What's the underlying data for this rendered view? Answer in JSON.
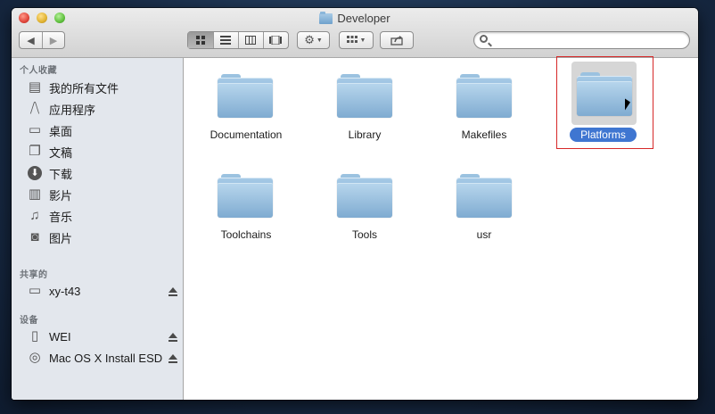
{
  "window": {
    "title": "Developer"
  },
  "toolbar": {
    "back_icon": "chevron-left",
    "forward_icon": "chevron-right",
    "view_buttons": [
      "icon-view",
      "list-view",
      "column-view",
      "coverflow-view"
    ],
    "action_icon": "gear",
    "arrange_icon": "grid-arrange",
    "share_icon": "share",
    "search_placeholder": ""
  },
  "sidebar": {
    "favorites_header": "个人收藏",
    "favorites": [
      {
        "label": "我的所有文件",
        "icon": "all-files-icon"
      },
      {
        "label": "应用程序",
        "icon": "applications-icon"
      },
      {
        "label": "桌面",
        "icon": "desktop-icon"
      },
      {
        "label": "文稿",
        "icon": "documents-icon"
      },
      {
        "label": "下载",
        "icon": "downloads-icon"
      },
      {
        "label": "影片",
        "icon": "movies-icon"
      },
      {
        "label": "音乐",
        "icon": "music-icon"
      },
      {
        "label": "图片",
        "icon": "pictures-icon"
      }
    ],
    "shared_header": "共享的",
    "shared": [
      {
        "label": "xy-t43",
        "icon": "computer-icon"
      }
    ],
    "devices_header": "设备",
    "devices": [
      {
        "label": "WEI",
        "icon": "drive-icon"
      },
      {
        "label": "Mac OS X Install ESD",
        "icon": "disc-icon"
      }
    ]
  },
  "content": {
    "folders": [
      {
        "name": "Documentation"
      },
      {
        "name": "Library"
      },
      {
        "name": "Makefiles"
      },
      {
        "name": "Platforms",
        "selected": true
      },
      {
        "name": "Toolchains"
      },
      {
        "name": "Tools"
      },
      {
        "name": "usr"
      }
    ]
  },
  "colors": {
    "selection": "#3f76d1",
    "highlight_box": "#d62828"
  }
}
